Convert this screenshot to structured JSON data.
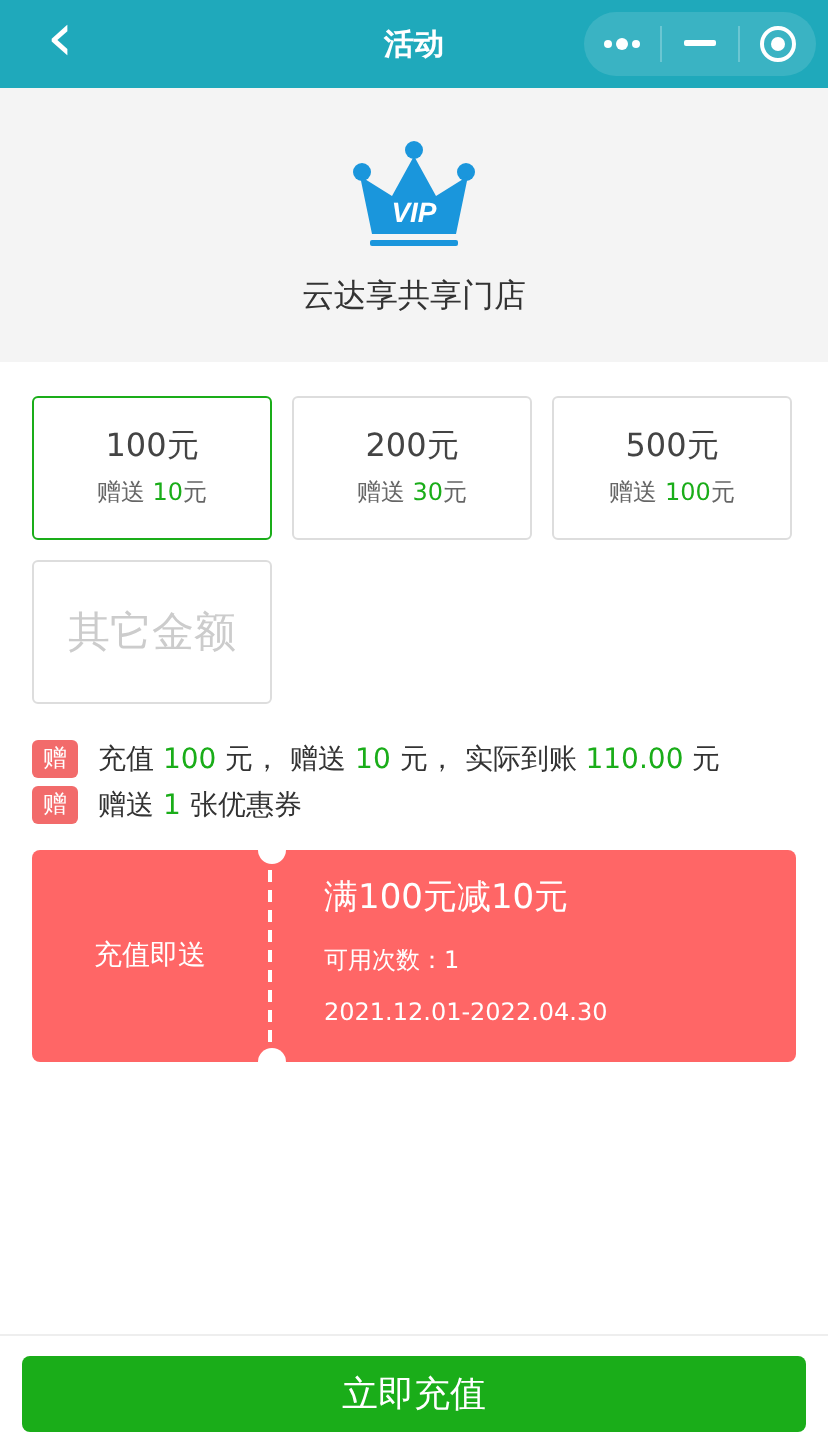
{
  "nav_bar": {
    "back": "‹",
    "title": "活动"
  },
  "store": {
    "name": "云达享共享门店",
    "logo_text": "VIP"
  },
  "options": [
    {
      "kind": "preset",
      "amount": "100元",
      "bonus_label": "赠送",
      "bonus_value": "10",
      "bonus_unit": "元",
      "selected": true
    },
    {
      "kind": "preset",
      "amount": "200元",
      "bonus_label": "赠送",
      "bonus_value": "30",
      "bonus_unit": "元",
      "selected": false
    },
    {
      "kind": "preset",
      "amount": "500元",
      "bonus_label": "赠送",
      "bonus_value": "100",
      "bonus_unit": "元",
      "selected": false
    },
    {
      "kind": "custom",
      "amount": "其它金额",
      "selected": false
    }
  ],
  "gifts": [
    {
      "badge": "赠",
      "parts": [
        {
          "kind": "text",
          "text": "充值 "
        },
        {
          "kind": "value",
          "text": "100"
        },
        {
          "kind": "text",
          "text": " 元， 赠送 "
        },
        {
          "kind": "value",
          "text": "10"
        },
        {
          "kind": "text",
          "text": " 元， 实际到账 "
        },
        {
          "kind": "value",
          "text": "110.00"
        },
        {
          "kind": "text",
          "text": " 元"
        }
      ]
    },
    {
      "badge": "赠",
      "parts": [
        {
          "kind": "text",
          "text": "赠送 "
        },
        {
          "kind": "value",
          "text": "1"
        },
        {
          "kind": "text",
          "text": " 张优惠券"
        }
      ]
    }
  ],
  "coupon": {
    "label": "充值即送",
    "title": "满100元减10元",
    "uses": "可用次数：1",
    "validity": "2021.12.01-2022.04.30"
  },
  "submit": "立即充值"
}
